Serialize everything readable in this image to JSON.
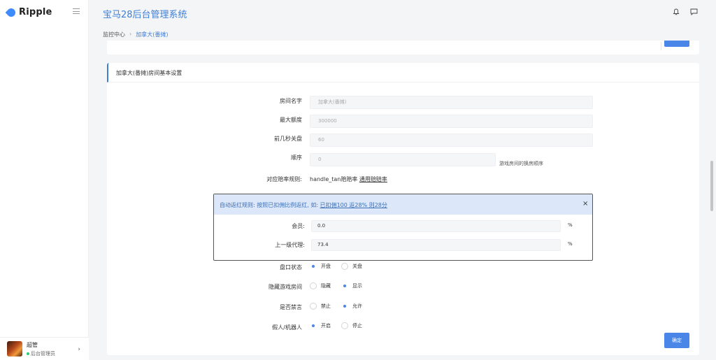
{
  "brand": {
    "name": "Ripple",
    "accent": "#3d8bfd"
  },
  "header": {
    "title": "宝马28后台管理系统"
  },
  "breadcrumb": {
    "items": [
      "监控中心",
      "加拿大(番摊)"
    ]
  },
  "user": {
    "name": "超管",
    "role": "后台管理员"
  },
  "card": {
    "title": "加拿大(番摊)房间基本设置",
    "fields": {
      "room_name": {
        "label": "房间名字",
        "value": "加拿大(番摊)"
      },
      "max_amount": {
        "label": "最大额度",
        "value": "300000"
      },
      "close_seconds": {
        "label": "前几秒关盘",
        "value": "60"
      },
      "order": {
        "label": "顺序",
        "value": "0",
        "help": "游戏房间的换房顺序"
      },
      "odds_rule": {
        "label": "对应赔率规则:",
        "text": "handle_tan赔赔率",
        "link": "通用赔赔率"
      }
    },
    "radios": {
      "market_status": {
        "label": "盘口状态",
        "opt1": "开盘",
        "opt2": "关盘",
        "selected": "开盘"
      },
      "hide_room": {
        "label": "隐藏游戏房间",
        "opt1": "隐藏",
        "opt2": "显示",
        "selected": "显示"
      },
      "mute": {
        "label": "是否禁言",
        "opt1": "禁止",
        "opt2": "允许",
        "selected": "允许"
      },
      "robot": {
        "label": "假人/机器人",
        "opt1": "开启",
        "opt2": "停止",
        "selected": "开启"
      }
    },
    "confirm_label": "确定"
  },
  "modal": {
    "title": "自动返红规则: 按照已扣佣比例返红, 如:",
    "title_link": "已扣佣100 返28% 则28分",
    "close_glyph": "×",
    "member": {
      "label": "会员:",
      "value": "0.0",
      "unit": "%"
    },
    "agent": {
      "label": "上一级代理:",
      "value": "73.4",
      "unit": "%"
    }
  }
}
